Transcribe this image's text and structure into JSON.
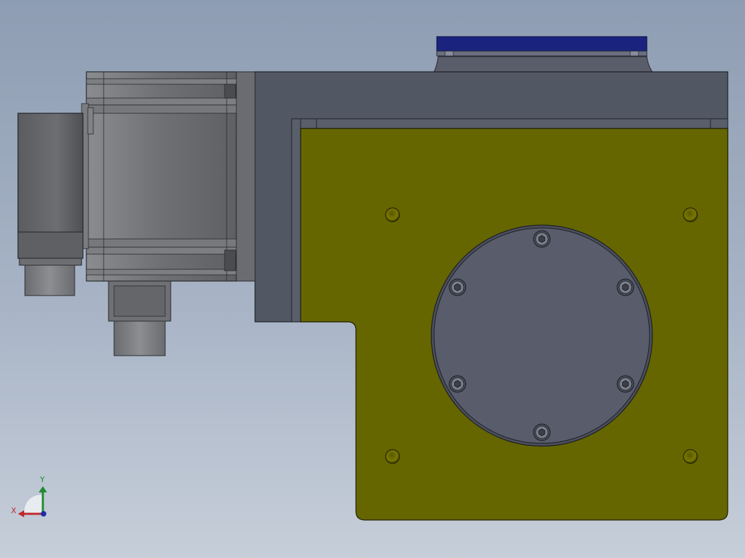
{
  "triad": {
    "x_label": "X",
    "y_label": "Y",
    "x_color": "#c0272d",
    "y_color": "#1f8a2e",
    "z_color": "#1d2ea8"
  },
  "colors": {
    "background_top": "#8e9db3",
    "background_bottom": "#c6ced9",
    "mounting_plate": "#666600",
    "frame": "#525764",
    "motor_body": "#6e7074",
    "cover_disc": "#585c6b",
    "top_bar": "#1a237e"
  },
  "scene": {
    "component_names": [
      "servo-motor",
      "motor-connector",
      "encoder-cap",
      "rotary-indexer-frame",
      "mounting-plate",
      "output-cover-disc",
      "top-mount-bar"
    ],
    "plate_holes": 4,
    "cover_screws": 6
  }
}
